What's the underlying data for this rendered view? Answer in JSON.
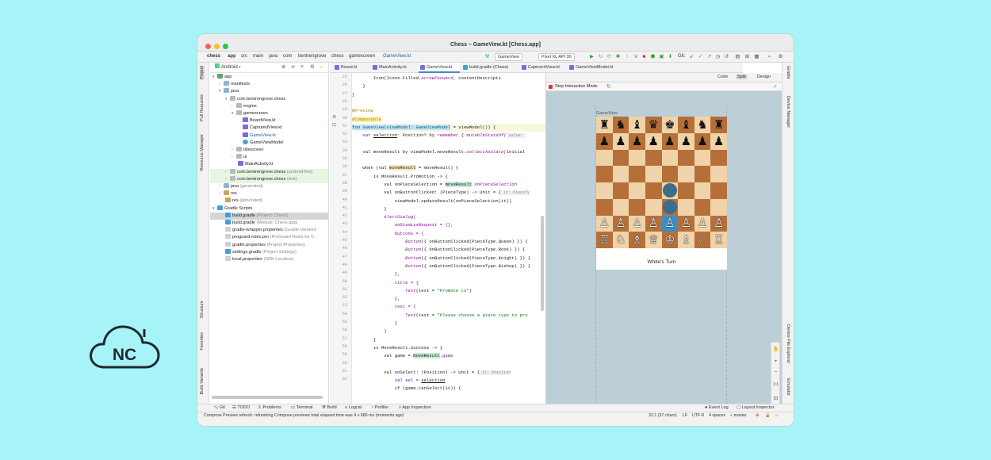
{
  "brand_logo_text": "NC",
  "window": {
    "title": "Chess – GameView.kt [Chess.app]"
  },
  "toolbar": {
    "breadcrumbs": [
      "chess",
      "app",
      "src",
      "main",
      "java",
      "com",
      "bentrengrove",
      "chess",
      "gamescreen",
      "GameView.kt"
    ],
    "run_config": "GameView",
    "device": "Pixel XL API 30",
    "git_label": "Git:"
  },
  "left_strip": [
    "Project",
    "Pull Requests",
    "Resource Manager",
    "Structure",
    "Favorites",
    "Build Variants"
  ],
  "right_strip": [
    "Gradle",
    "Device Manager",
    "Device File Explorer",
    "Emulator"
  ],
  "project_panel": {
    "view": "Android",
    "tree": [
      {
        "label": "app",
        "extra": ""
      },
      {
        "label": "manifests",
        "extra": ""
      },
      {
        "label": "java",
        "extra": ""
      },
      {
        "label": "com.bentrengrove.chess",
        "extra": ""
      },
      {
        "label": "engine",
        "extra": ""
      },
      {
        "label": "gamescreen",
        "extra": ""
      },
      {
        "label": "BoardView.kt",
        "extra": ""
      },
      {
        "label": "CapturedView.kt",
        "extra": ""
      },
      {
        "label": "GameView.kt",
        "extra": ""
      },
      {
        "label": "GameViewModel",
        "extra": ""
      },
      {
        "label": "titlescreen",
        "extra": ""
      },
      {
        "label": "ui",
        "extra": ""
      },
      {
        "label": "MainActivity.kt",
        "extra": ""
      },
      {
        "label": "com.bentrengrove.chess",
        "extra": "(androidTest)"
      },
      {
        "label": "com.bentrengrove.chess",
        "extra": "(test)"
      },
      {
        "label": "java",
        "extra": "(generated)"
      },
      {
        "label": "res",
        "extra": ""
      },
      {
        "label": "res",
        "extra": "(generated)"
      },
      {
        "label": "Gradle Scripts",
        "extra": ""
      },
      {
        "label": "build.gradle",
        "extra": "(Project: Chess)"
      },
      {
        "label": "build.gradle",
        "extra": "(Module: Chess.app)"
      },
      {
        "label": "gradle-wrapper.properties",
        "extra": "(Gradle Version)"
      },
      {
        "label": "proguard-rules.pro",
        "extra": "(ProGuard Rules for C"
      },
      {
        "label": "gradle.properties",
        "extra": "(Project Properties)"
      },
      {
        "label": "settings.gradle",
        "extra": "(Project Settings)"
      },
      {
        "label": "local.properties",
        "extra": "(SDK Location)"
      }
    ]
  },
  "editor_tabs": [
    "Board.kt",
    "MainActivity.kt",
    "GameView.kt",
    "build.gradle (Chess)",
    "CapturedView.kt",
    "GameViewModel.kt"
  ],
  "line_numbers": [
    "25",
    "26",
    "27",
    "28",
    "29",
    "30",
    "31",
    "32",
    "33",
    "34",
    "35",
    "36",
    "37",
    "38",
    "39",
    "40",
    "41",
    "42",
    "43",
    "44",
    "45",
    "46",
    "47",
    "48",
    "49",
    "50",
    "51",
    "52",
    "53",
    "54",
    "55",
    "56",
    "57",
    "58",
    "59",
    "60",
    "61",
    "62"
  ],
  "code": {
    "l25a": "        Icon(Icons.Filled.",
    "l25b": "ArrowForward",
    "l25c": ", contentDescripti",
    "l26": "    }",
    "l27": "}",
    "l29": "@Preview",
    "l30a": "@",
    "l30b": "Composable",
    "l31a": "fun ",
    "l31b": "GameView(viewModel: GameViewModel",
    "l31c": " = viewModel()) {",
    "l32a": "    var ",
    "l32b": "selection",
    "l32c": ": Position? by ",
    "l32d": "remember",
    "l32e": " { ",
    "l32f": "mutableStateOf(",
    "l32g": " value: ",
    "l34a": "    val moveResult by viewModel.moveResult.",
    "l34b": "collectAsState(",
    "l34c": "initial",
    "l36a": "    when (val ",
    "l36b": "moveResult",
    "l36c": " = moveResult) {",
    "l37a": "        is ",
    "l37b": "MoveResult.Promotion -> {",
    "l38a": "            val onPieceSelection = ",
    "l38b": "moveResult",
    "l38c": ".onPieceSelection",
    "l39a": "            val onButtonClicked: (PieceType) -> Unit = {",
    "l39b": " it: PieceTy",
    "l40": "                viewModel.updateResult(onPieceSelection(it))",
    "l41": "            }",
    "l42": "            AlertDialog(",
    "l43": "                onDismissRequest = {},",
    "l44": "                buttons = {",
    "l45a": "                    ",
    "l45b": "Button",
    "l45c": "({ onButtonClicked(PieceType.Queen) }) {",
    "l46c": "({ onButtonClicked(PieceType.Rook) }) {",
    "l47c": "({ onButtonClicked(PieceType.Knight) }) {",
    "l48c": "({ onButtonClicked(PieceType.Bishop) }) {",
    "l49": "                },",
    "l50": "                title = {",
    "l51a": "                    ",
    "l51b": "Text",
    "l51c": "(text = ",
    "l51d": "\"Promote to\"",
    "l51e": ")",
    "l52": "                },",
    "l53": "                text = {",
    "l54d": "\"Please choose a piece type to pro",
    "l55": "                }",
    "l56": "            )",
    "l57": "        }",
    "l58a": "        is ",
    "l58b": "MoveResult.Success -> {",
    "l59a": "            val game = ",
    "l59b": "moveResult",
    "l59c": ".game",
    "l61a": "            val onSelect: (Position) -> Unit = {",
    "l61b": " it: Position",
    "l62a": "                val sel = ",
    "l62b": "selection",
    "l63": "                if (game.canSelect(it)) {"
  },
  "preview": {
    "modes": [
      "Code",
      "Split",
      "Design"
    ],
    "stop_label": "Stop Interactive Mode",
    "component_label": "GameView",
    "turn_text": "White's Turn",
    "zoom_ratio": "1:1",
    "board": [
      [
        "♜",
        "♞",
        "♝",
        "♛",
        "♚",
        "♝",
        "♞",
        "♜"
      ],
      [
        "♟",
        "♟",
        "♟",
        "♟",
        "♟",
        "♟",
        "♟",
        "♟"
      ],
      [
        "",
        "",
        "",
        "",
        "",
        "",
        "",
        ""
      ],
      [
        "",
        "",
        "",
        "",
        "",
        "",
        "",
        ""
      ],
      [
        "",
        "",
        "",
        "",
        "",
        "",
        "",
        ""
      ],
      [
        "",
        "",
        "",
        "",
        "",
        "",
        "",
        ""
      ],
      [
        "♙",
        "♙",
        "♙",
        "♙",
        "♙",
        "♙",
        "♙",
        "♙"
      ],
      [
        "♖",
        "♘",
        "♗",
        "♕",
        "♔",
        "♗",
        "♘",
        "♖"
      ]
    ],
    "selected_square": "e2",
    "move_hints": [
      "e4",
      "e3"
    ]
  },
  "bottom_tools": [
    "Git",
    "TODO",
    "Problems",
    "Terminal",
    "Build",
    "Logcat",
    "Profiler",
    "App Inspection",
    "Event Log",
    "Layout Inspector"
  ],
  "status": {
    "message": "Compose Preview refresh: refreshing Compose previews total elapsed time was 4 s 686 ms (moments ago)",
    "position": "31:1 (37 chars)",
    "line_sep": "LF",
    "encoding": "UTF-8",
    "indent": "4 spaces",
    "branch": "master"
  },
  "colors": {
    "background": "#a6f4f7",
    "light_square": "#f0d3a8",
    "dark_square": "#b5703a",
    "selected": "#3b8ec2"
  }
}
